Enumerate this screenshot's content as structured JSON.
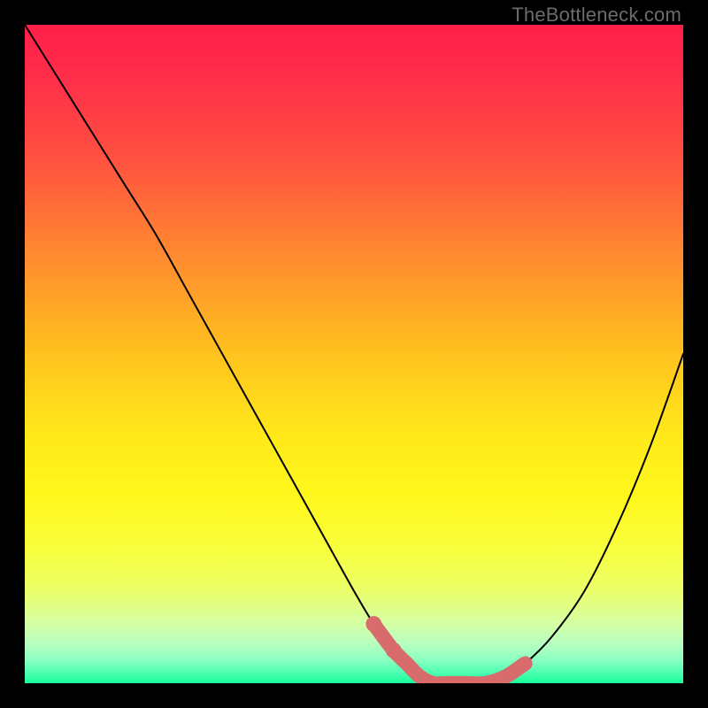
{
  "watermark": "TheBottleneck.com",
  "colors": {
    "black": "#000000",
    "curve": "#000000",
    "thick_accent": "#d86b6b",
    "gradient_stops": [
      {
        "offset": 0.0,
        "color": "#ff1f4a"
      },
      {
        "offset": 0.08,
        "color": "#ff2e4a"
      },
      {
        "offset": 0.2,
        "color": "#ff5040"
      },
      {
        "offset": 0.35,
        "color": "#ff8a30"
      },
      {
        "offset": 0.5,
        "color": "#ffc21e"
      },
      {
        "offset": 0.62,
        "color": "#ffe81a"
      },
      {
        "offset": 0.72,
        "color": "#fff81c"
      },
      {
        "offset": 0.8,
        "color": "#f8ff40"
      },
      {
        "offset": 0.86,
        "color": "#eaff6a"
      },
      {
        "offset": 0.905,
        "color": "#d8ffa0"
      },
      {
        "offset": 0.94,
        "color": "#b7ffc0"
      },
      {
        "offset": 0.965,
        "color": "#8affc2"
      },
      {
        "offset": 0.985,
        "color": "#4affb0"
      },
      {
        "offset": 1.0,
        "color": "#1aff9a"
      }
    ]
  },
  "chart_data": {
    "type": "line",
    "title": "",
    "xlabel": "",
    "ylabel": "",
    "xlim": [
      0,
      100
    ],
    "ylim": [
      0,
      100
    ],
    "series": [
      {
        "name": "curve",
        "x": [
          0,
          5,
          10,
          15,
          20,
          25,
          30,
          35,
          40,
          45,
          50,
          53,
          56,
          58,
          60,
          62,
          64,
          67,
          70,
          73,
          76,
          80,
          85,
          90,
          95,
          100
        ],
        "y": [
          100,
          92,
          84,
          76,
          68,
          59,
          50,
          41,
          32,
          23,
          14,
          9,
          5,
          3,
          1,
          0,
          0,
          0,
          0,
          1,
          3,
          7,
          14,
          24,
          36,
          50
        ]
      },
      {
        "name": "highlight",
        "x": [
          53,
          56,
          58,
          60,
          62,
          64,
          67,
          70,
          73,
          76
        ],
        "y": [
          9,
          5,
          3,
          1,
          0,
          0,
          0,
          0,
          1,
          3
        ]
      }
    ],
    "highlight_dots": [
      {
        "x": 53,
        "y": 9
      },
      {
        "x": 56,
        "y": 5
      }
    ]
  }
}
